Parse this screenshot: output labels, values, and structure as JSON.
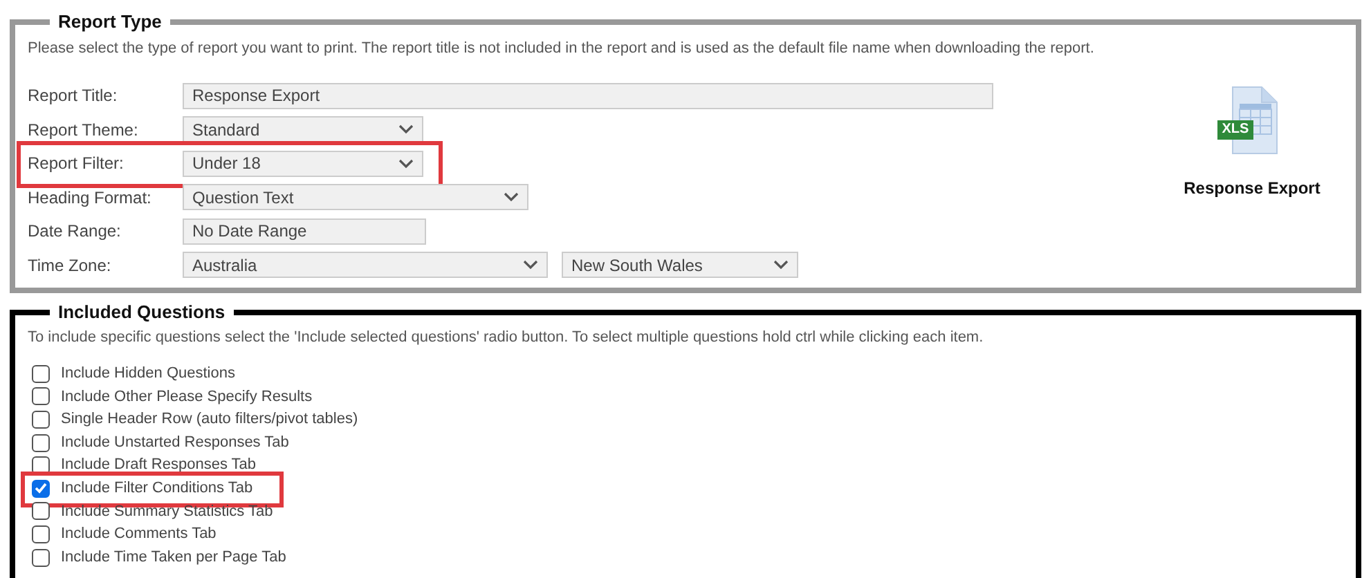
{
  "report_type": {
    "legend": "Report Type",
    "description": "Please select the type of report you want to print. The report title is not included in the report and is used as the default file name when downloading the report.",
    "fields": [
      {
        "label": "Report Title:",
        "kind": "text",
        "value": "Response Export",
        "highlighted": false
      },
      {
        "label": "Report Theme:",
        "kind": "select",
        "value": "Standard",
        "highlighted": false
      },
      {
        "label": "Report Filter:",
        "kind": "select",
        "value": "Under 18",
        "highlighted": true
      },
      {
        "label": "Heading Format:",
        "kind": "select",
        "value": "Question Text",
        "highlighted": false
      },
      {
        "label": "Date Range:",
        "kind": "text",
        "value": "No Date Range",
        "highlighted": false
      },
      {
        "label": "Time Zone:",
        "kind": "select_pair",
        "value": "Australia",
        "second_value": "New South Wales",
        "highlighted": false
      }
    ],
    "export": {
      "badge": "XLS",
      "label": "Response Export"
    }
  },
  "included_questions": {
    "legend": "Included Questions",
    "description": "To include specific questions select the 'Include selected questions' radio button. To select multiple questions hold ctrl while clicking each item.",
    "options": [
      {
        "label": "Include Hidden Questions",
        "checked": false,
        "highlighted": false
      },
      {
        "label": "Include Other Please Specify Results",
        "checked": false,
        "highlighted": false
      },
      {
        "label": "Single Header Row (auto filters/pivot tables)",
        "checked": false,
        "highlighted": false
      },
      {
        "label": "Include Unstarted Responses Tab",
        "checked": false,
        "highlighted": false
      },
      {
        "label": "Include Draft Responses Tab",
        "checked": false,
        "highlighted": false
      },
      {
        "label": "Include Filter Conditions Tab",
        "checked": true,
        "highlighted": true
      },
      {
        "label": "Include Summary Statistics Tab",
        "checked": false,
        "highlighted": false
      },
      {
        "label": "Include Comments Tab",
        "checked": false,
        "highlighted": false
      },
      {
        "label": "Include Time Taken per Page Tab",
        "checked": false,
        "highlighted": false
      }
    ]
  }
}
